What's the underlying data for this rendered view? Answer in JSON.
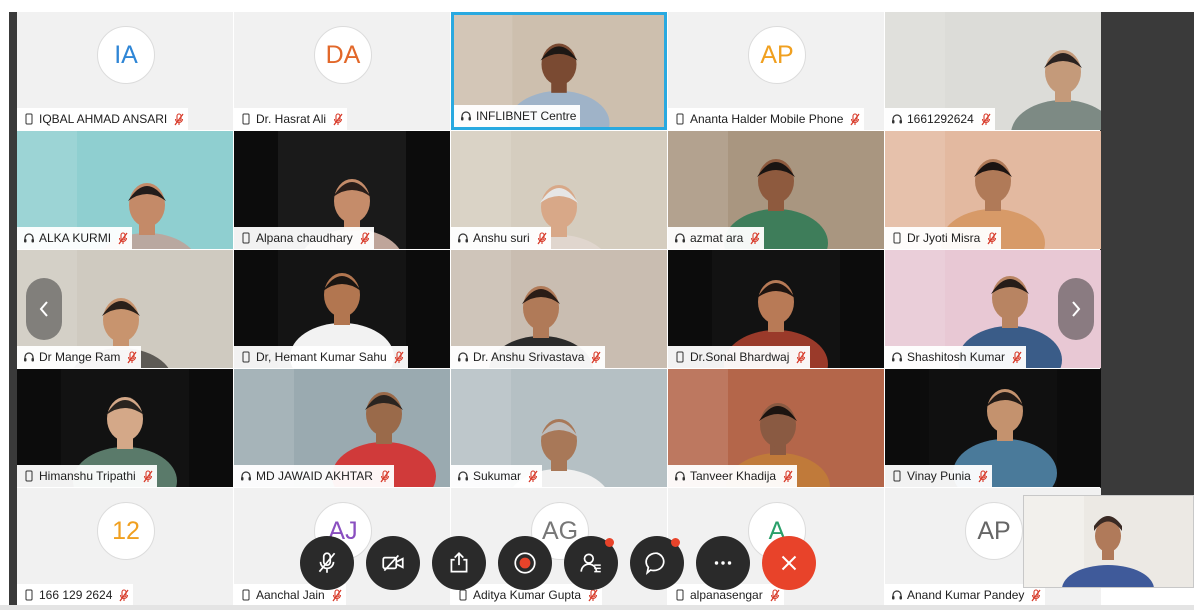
{
  "meeting": {
    "participants": [
      {
        "name": "IQBAL AHMAD ANSARI",
        "initials": "IA",
        "avatar_color": "#2f86d6",
        "device": "mobile",
        "muted": true,
        "video": false
      },
      {
        "name": "Dr. Hasrat Ali",
        "initials": "DA",
        "avatar_color": "#e2682a",
        "device": "mobile",
        "muted": true,
        "video": false
      },
      {
        "name": "INFLIBNET Centre",
        "device": "headset",
        "muted": false,
        "video": true,
        "active_speaker": true
      },
      {
        "name": "Ananta Halder Mobile Phone",
        "initials": "AP",
        "avatar_color": "#f0a020",
        "device": "mobile",
        "muted": true,
        "video": false
      },
      {
        "name": "1661292624",
        "device": "headset",
        "muted": true,
        "video": true
      },
      {
        "name": "ALKA KURMI",
        "device": "headset",
        "muted": true,
        "video": true
      },
      {
        "name": "Alpana chaudhary",
        "device": "mobile",
        "muted": true,
        "video": true
      },
      {
        "name": "Anshu suri",
        "device": "headset",
        "muted": true,
        "video": true
      },
      {
        "name": "azmat ara",
        "device": "headset",
        "muted": true,
        "video": true
      },
      {
        "name": "Dr Jyoti Misra",
        "device": "mobile",
        "muted": true,
        "video": true
      },
      {
        "name": "Dr Mange Ram",
        "device": "headset",
        "muted": true,
        "video": true
      },
      {
        "name": "Dr, Hemant Kumar Sahu",
        "device": "mobile",
        "muted": true,
        "video": true
      },
      {
        "name": "Dr. Anshu Srivastava",
        "device": "headset",
        "muted": true,
        "video": true
      },
      {
        "name": "Dr.Sonal Bhardwaj",
        "device": "mobile",
        "muted": true,
        "video": true
      },
      {
        "name": "Shashitosh Kumar",
        "device": "headset",
        "muted": true,
        "video": true
      },
      {
        "name": "Himanshu Tripathi",
        "device": "mobile",
        "muted": true,
        "video": true
      },
      {
        "name": "MD JAWAID AKHTAR",
        "device": "headset",
        "muted": true,
        "video": true
      },
      {
        "name": "Sukumar",
        "device": "headset",
        "muted": true,
        "video": true
      },
      {
        "name": "Tanveer Khadija",
        "device": "headset",
        "muted": true,
        "video": true
      },
      {
        "name": "Vinay Punia",
        "device": "mobile",
        "muted": true,
        "video": true
      },
      {
        "name": "166 129 2624",
        "initials": "12",
        "avatar_color": "#f0a020",
        "device": "mobile",
        "muted": true,
        "video": false
      },
      {
        "name": "Aanchal Jain",
        "initials": "AJ",
        "avatar_color": "#8a4fc0",
        "device": "mobile",
        "muted": true,
        "video": false
      },
      {
        "name": "Aditya Kumar Gupta",
        "initials": "AG",
        "avatar_color": "#777777",
        "device": "mobile",
        "muted": true,
        "video": false
      },
      {
        "name": "alpanasengar",
        "initials": "A",
        "avatar_color": "#2aa06a",
        "device": "mobile",
        "muted": true,
        "video": false
      },
      {
        "name": "Anand Kumar Pandey",
        "initials": "AP",
        "avatar_color": "#666666",
        "device": "headset",
        "muted": true,
        "video": false
      }
    ]
  },
  "controls": {
    "items": [
      {
        "name": "mute-button",
        "icon": "mic-off-icon"
      },
      {
        "name": "video-button",
        "icon": "video-off-icon"
      },
      {
        "name": "share-button",
        "icon": "share-icon"
      },
      {
        "name": "record-button",
        "icon": "record-icon"
      },
      {
        "name": "participants-button",
        "icon": "participants-icon",
        "badge": true
      },
      {
        "name": "chat-button",
        "icon": "chat-icon",
        "badge": true
      },
      {
        "name": "more-button",
        "icon": "more-icon"
      },
      {
        "name": "leave-button",
        "icon": "close-icon"
      }
    ],
    "colors": {
      "default": "#2a2a2a",
      "leave": "#e8432a",
      "badge": "#e8432a",
      "record": "#e8432a"
    }
  },
  "colors": {
    "active_border": "#29a9e0",
    "mute_icon": "#d83b2a",
    "panel": "#3a3a3a"
  }
}
